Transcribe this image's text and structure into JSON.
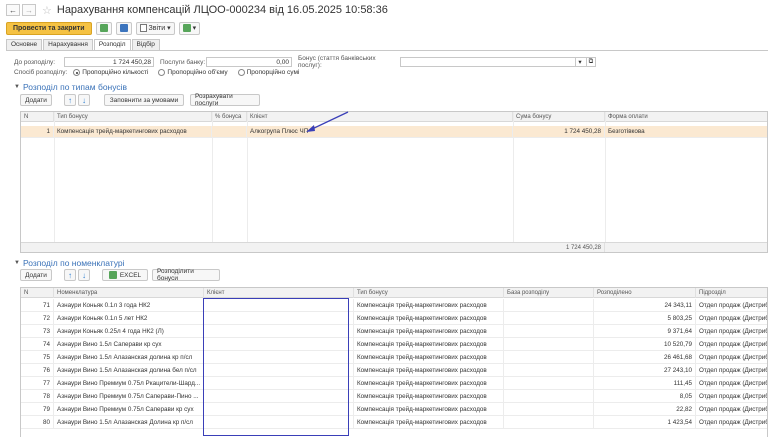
{
  "window": {
    "title": "Нарахування компенсацій ЛЦОО-000234 від 16.05.2025 10:58:36"
  },
  "toolbar": {
    "post_close": "Провести та закрити",
    "reports": "Звіти"
  },
  "tabs": [
    "Основне",
    "Нарахування",
    "Розподіл",
    "Відбір"
  ],
  "form": {
    "to_distribute_label": "До розподілу:",
    "to_distribute_value": "1 724 450,28",
    "bank_services_label": "Послуги банку:",
    "bank_services_value": "0,00",
    "bonus_label": "Бонус (стаття банківських послуг):",
    "method_label": "Спосіб розподілу:",
    "methods": [
      "Пропорційно кількості",
      "Пропорційно об'єму",
      "Пропорційно сумі"
    ]
  },
  "section1": {
    "title": "Розподіл по типам бонусів",
    "add": "Додати",
    "fill": "Заповнити за умовами",
    "calc": "Розрахувати послуги",
    "columns": [
      "N",
      "Тип бонусу",
      "% бонуса",
      "Клієнт",
      "Сума бонусу",
      "Форма оплати"
    ],
    "rows": [
      {
        "n": "1",
        "type": "Компенсація трейд-маркетингових расходов",
        "pct": "",
        "client": "Алкогрупа Плюс ЧП",
        "sum": "1 724 450,28",
        "pay": "Безготівкова"
      }
    ],
    "total": "1 724 450,28"
  },
  "section2": {
    "title": "Розподіл по номенклатурі",
    "add": "Додати",
    "excel": "EXCEL",
    "distribute": "Розподілити бонуси",
    "columns": [
      "N",
      "Номенклатура",
      "Клієнт",
      "Тип бонусу",
      "База розподілу",
      "Розподілено",
      "Підрозділ"
    ],
    "rows": [
      {
        "n": "71",
        "item": "Азнаури Коньяк 0.1л 3 года НК2",
        "type": "Компенсація трейд-маркетингових расходов",
        "dist": "24 343,11",
        "dept": "Отдел продаж (Дистрибу"
      },
      {
        "n": "72",
        "item": "Азнаури Коньяк 0.1л 5 лет НК2",
        "type": "Компенсація трейд-маркетингових расходов",
        "dist": "5 803,25",
        "dept": "Отдел продаж (Дистрибу"
      },
      {
        "n": "73",
        "item": "Азнаури Коньяк 0.25л 4 года НК2 (Л)",
        "type": "Компенсація трейд-маркетингових расходов",
        "dist": "9 371,64",
        "dept": "Отдел продаж (Дистрибу"
      },
      {
        "n": "74",
        "item": "Азнаури Вино 1.5л Саперави кр сух",
        "type": "Компенсація трейд-маркетингових расходов",
        "dist": "10 520,79",
        "dept": "Отдел продаж (Дистрибу"
      },
      {
        "n": "75",
        "item": "Азнаури Вино 1.5л Алазанская долина кр п/сл",
        "type": "Компенсація трейд-маркетингових расходов",
        "dist": "26 461,68",
        "dept": "Отдел продаж (Дистрибу"
      },
      {
        "n": "76",
        "item": "Азнаури Вино 1.5л Алазанская долина бел п/сл",
        "type": "Компенсація трейд-маркетингових расходов",
        "dist": "27 243,10",
        "dept": "Отдел продаж (Дистрибу"
      },
      {
        "n": "77",
        "item": "Азнаури Вино Премиум 0.75л Ркацители-Шард...",
        "type": "Компенсація трейд-маркетингових расходов",
        "dist": "111,45",
        "dept": "Отдел продаж (Дистрибу"
      },
      {
        "n": "78",
        "item": "Азнаури Вино Премиум 0.75л Саперави-Пино ...",
        "type": "Компенсація трейд-маркетингових расходов",
        "dist": "8,05",
        "dept": "Отдел продаж (Дистрибу"
      },
      {
        "n": "79",
        "item": "Азнаури Вино Премиум 0.75л Саперави кр сух",
        "type": "Компенсація трейд-маркетингових расходов",
        "dist": "22,82",
        "dept": "Отдел продаж (Дистрибу"
      },
      {
        "n": "80",
        "item": "Азнаури Вино 1.5л Алазанская Долина кр п/сл",
        "type": "Компенсація трейд-маркетингових расходов",
        "dist": "1 423,54",
        "dept": "Отдел продаж (Дистрибу"
      }
    ]
  }
}
